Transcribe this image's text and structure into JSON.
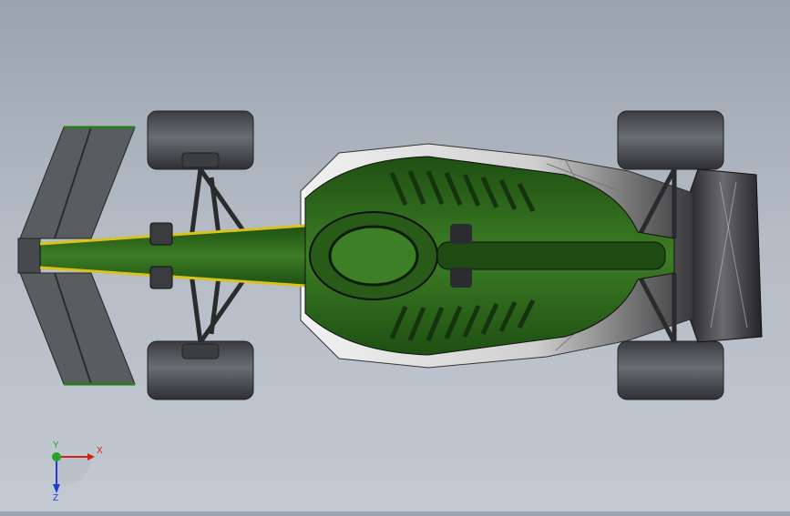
{
  "viewport": {
    "model": "formula-car-assembly",
    "view": "top",
    "colors": {
      "background_top": "#9aa3ae",
      "background_bottom": "#c3c9d1",
      "body_green": "#2f6a1e",
      "body_green_dark": "#1f4a12",
      "accent_yellow": "#d9c21a",
      "tire": "#4a4c50",
      "wing": "#56595c",
      "floor": "#e8e8e8",
      "carbon": "#2b2b2e"
    }
  },
  "triad": {
    "x_label": "X",
    "y_label": "Y",
    "z_label": "Z",
    "x_color": "#d0201a",
    "y_color": "#21a52c",
    "z_color": "#1f3dd6"
  }
}
